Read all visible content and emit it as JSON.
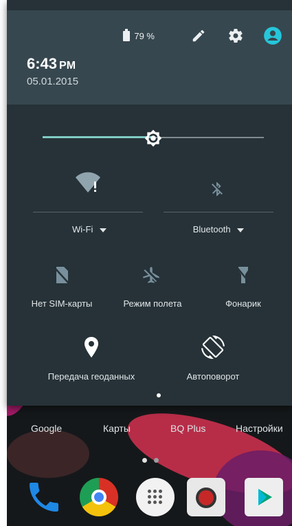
{
  "status": {
    "battery": "79 %"
  },
  "header": {
    "time": "6:43",
    "ampm": "PM",
    "date": "05.01.2015"
  },
  "brightness": {
    "level": 0.5
  },
  "tiles": {
    "wifi": {
      "label": "Wi-Fi"
    },
    "bluetooth": {
      "label": "Bluetooth"
    },
    "sim": {
      "label": "Нет SIM-карты"
    },
    "airplane": {
      "label": "Режим полета"
    },
    "flashlight": {
      "label": "Фонарик"
    },
    "location": {
      "label": "Передача геоданных"
    },
    "rotation": {
      "label": "Автоповорот"
    }
  },
  "home": {
    "apps": [
      "Google",
      "Карты",
      "BQ Plus",
      "Настройки"
    ]
  },
  "colors": {
    "shade_bg": "#263238",
    "header_bg": "#37474f",
    "accent": "#80cbc4",
    "avatar": "#26c6da"
  }
}
